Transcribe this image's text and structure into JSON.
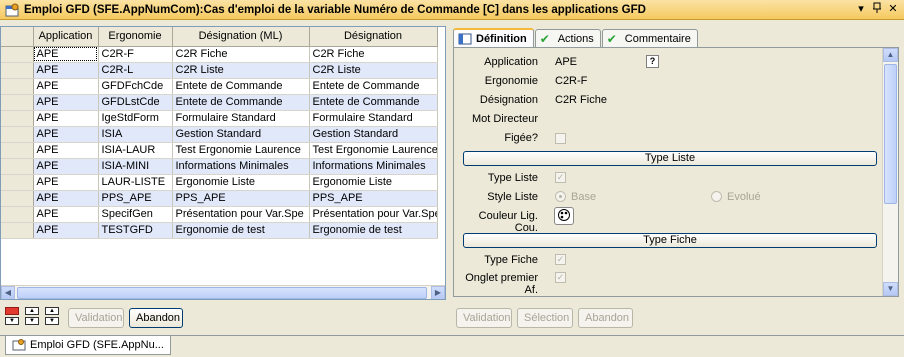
{
  "window": {
    "title": "Emploi GFD (SFE.AppNumCom):Cas d'emploi de la variable Numéro de Commande [C] dans les applications GFD",
    "pin_glyph": "░",
    "dropdown_glyph": "▾",
    "close_glyph": "✕"
  },
  "grid": {
    "columns": [
      "Application",
      "Ergonomie",
      "Désignation (ML)",
      "Désignation"
    ],
    "rows": [
      [
        "APE",
        "C2R-F",
        "C2R Fiche",
        "C2R Fiche"
      ],
      [
        "APE",
        "C2R-L",
        "C2R Liste",
        "C2R Liste"
      ],
      [
        "APE",
        "GFDFchCde",
        "Entete de Commande",
        "Entete de Commande"
      ],
      [
        "APE",
        "GFDLstCde",
        "Entete de Commande",
        "Entete de Commande"
      ],
      [
        "APE",
        "IgeStdForm",
        "Formulaire Standard",
        "Formulaire Standard"
      ],
      [
        "APE",
        "ISIA",
        "Gestion Standard",
        "Gestion Standard"
      ],
      [
        "APE",
        "ISIA-LAUR",
        "Test Ergonomie Laurence",
        "Test Ergonomie Laurence"
      ],
      [
        "APE",
        "ISIA-MINI",
        "Informations Minimales",
        "Informations Minimales"
      ],
      [
        "APE",
        "LAUR-LISTE",
        "Ergonomie Liste",
        "Ergonomie Liste"
      ],
      [
        "APE",
        "PPS_APE",
        "PPS_APE",
        "PPS_APE"
      ],
      [
        "APE",
        "SpecifGen",
        "Présentation pour Var.Spe",
        "Présentation pour Var.Spe"
      ],
      [
        "APE",
        "TESTGFD",
        "Ergonomie de test",
        "Ergonomie de test"
      ]
    ]
  },
  "left_buttons": {
    "validation": "Validation",
    "abandon": "Abandon"
  },
  "tabs": [
    "Définition",
    "Actions",
    "Commentaire"
  ],
  "definition": {
    "application_label": "Application",
    "application_value": "APE",
    "help_glyph": "?",
    "ergonomie_label": "Ergonomie",
    "ergonomie_value": "C2R-F",
    "designation_label": "Désignation",
    "designation_value": "C2R Fiche",
    "mot_directeur_label": "Mot Directeur",
    "figee_label": "Figée?",
    "type_liste_section": "Type Liste",
    "type_liste_label": "Type Liste",
    "style_liste_label": "Style Liste",
    "style_base": "Base",
    "style_evolue": "Evolué",
    "couleur_label": "Couleur Lig. Cou.",
    "type_fiche_section": "Type Fiche",
    "type_fiche_label": "Type Fiche",
    "onglet_label": "Onglet premier Af."
  },
  "right_buttons": {
    "validation": "Validation",
    "selection": "Sélection",
    "abandon": "Abandon"
  },
  "bottom_tab": {
    "label": "Emploi GFD (SFE.AppNu..."
  },
  "colors": {
    "title_bar": "#f5c95f",
    "alt_row": "#e0e8fa",
    "active_tab_accent": "#f5b83b",
    "check_green": "#2aa335"
  }
}
